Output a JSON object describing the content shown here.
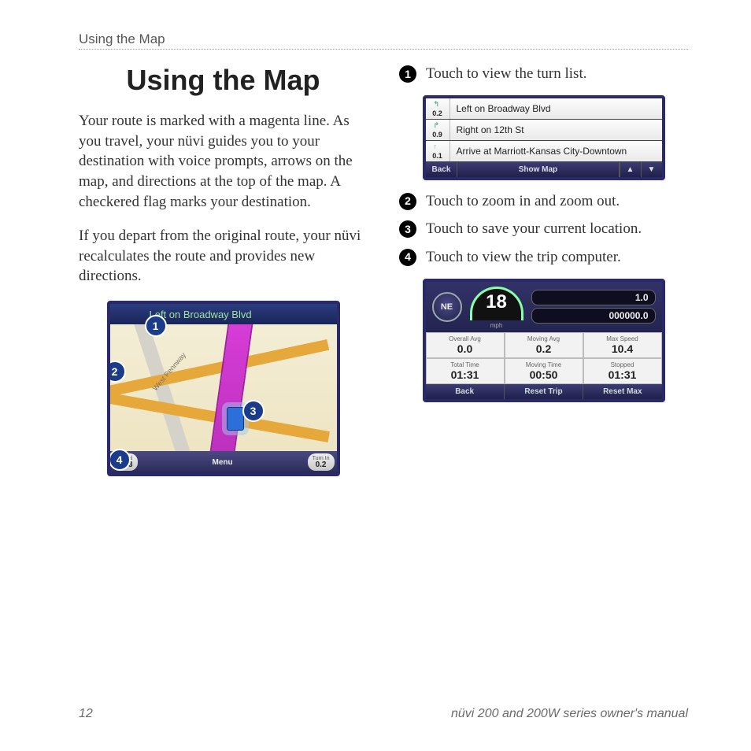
{
  "header": {
    "running_title": "Using the Map"
  },
  "title": "Using the Map",
  "body": {
    "p1": "Your route is marked with a magenta line. As you travel, your nüvi guides you to your destination with voice prompts, arrows on the map, and directions at the top of the map. A checkered flag marks your destination.",
    "p2": "If you depart from the original route, your nüvi recalculates the route and provides new directions."
  },
  "callouts": [
    {
      "num": "1",
      "text": "Touch to view the turn list."
    },
    {
      "num": "2",
      "text": "Touch to zoom in and zoom out."
    },
    {
      "num": "3",
      "text": "Touch to save your current location."
    },
    {
      "num": "4",
      "text": "Touch to view the trip computer."
    }
  ],
  "map_screenshot": {
    "direction_text": "Left on Broadway Blvd",
    "road_label": "West Pennway",
    "bottom": {
      "arrival_label": "Arrival",
      "arrival_value": "1:43",
      "menu_label": "Menu",
      "turnin_label": "Turn In",
      "turnin_value": "0.2"
    },
    "markers": {
      "m1": "1",
      "m2": "2",
      "m3": "3",
      "m4": "4"
    }
  },
  "turnlist": {
    "items": [
      {
        "dist": "0.2",
        "text": "Left on Broadway Blvd"
      },
      {
        "dist": "0.9",
        "text": "Right on 12th St"
      },
      {
        "dist": "0.1",
        "text": "Arrive at Marriott-Kansas City-Downtown"
      }
    ],
    "footer": {
      "back": "Back",
      "showmap": "Show Map",
      "up": "▲",
      "down": "▼"
    }
  },
  "trip": {
    "compass": "NE",
    "speed": "18",
    "speed_unit": "mph",
    "odo1": "1.0",
    "odo2": "000000.0",
    "grid": [
      {
        "label": "Overall Avg",
        "value": "0.0"
      },
      {
        "label": "Moving Avg",
        "value": "0.2"
      },
      {
        "label": "Max Speed",
        "value": "10.4"
      },
      {
        "label": "Total Time",
        "value": "01:31"
      },
      {
        "label": "Moving Time",
        "value": "00:50"
      },
      {
        "label": "Stopped",
        "value": "01:31"
      }
    ],
    "footer": {
      "back": "Back",
      "reset_trip": "Reset Trip",
      "reset_max": "Reset Max"
    }
  },
  "footer": {
    "page": "12",
    "book": "nüvi 200 and 200W series owner's manual"
  }
}
